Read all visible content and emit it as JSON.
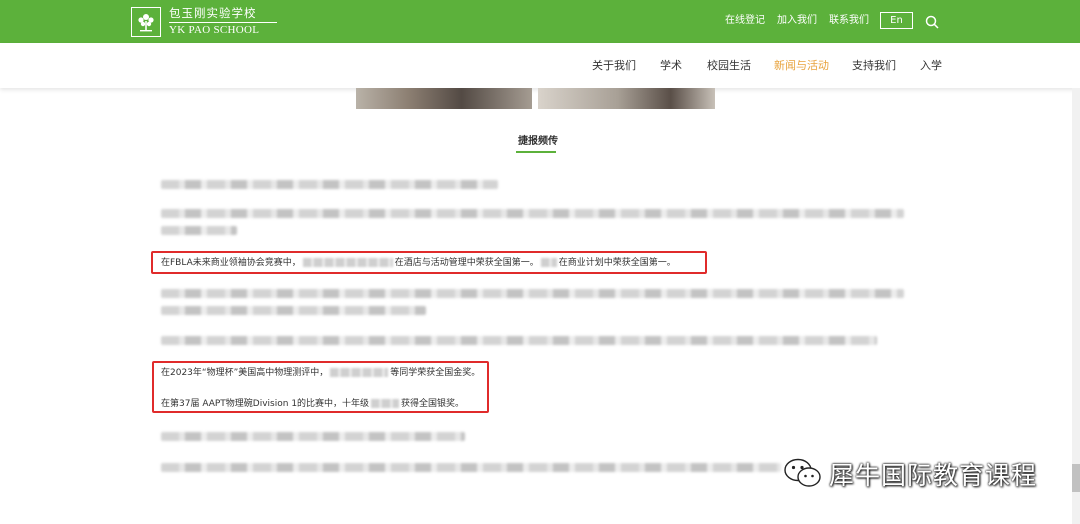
{
  "header": {
    "logo_cn": "包玉刚实验学校",
    "logo_en": "YK PAO SCHOOL",
    "links": [
      "在线登记",
      "加入我们",
      "联系我们"
    ],
    "lang_button": "En",
    "brand_color": "#5cb13b"
  },
  "nav": {
    "items": [
      "关于我们",
      "学术",
      "校园生活",
      "新闻与活动",
      "支持我们",
      "入学"
    ],
    "active": "新闻与活动",
    "active_color": "#e8a33d"
  },
  "section": {
    "title": "捷报频传"
  },
  "content": {
    "fbla_line": {
      "part1": "在FBLA未来商业领袖协会竞赛中，",
      "part2": "在酒店与活动管理中荣获全国第一。",
      "part3": "在商业计划中荣获全国第一。"
    },
    "physics_line": {
      "part1": "在2023年“物理杯”美国高中物理测评中，",
      "part2": "等同学荣获全国金奖。"
    },
    "aapt_line": {
      "part1": "在第37届 AAPT物理碗Division 1的比赛中，十年级",
      "part2": "获得全国银奖。"
    }
  },
  "watermark": {
    "text": "犀牛国际教育课程"
  },
  "highlight_color": "#e02b2b"
}
